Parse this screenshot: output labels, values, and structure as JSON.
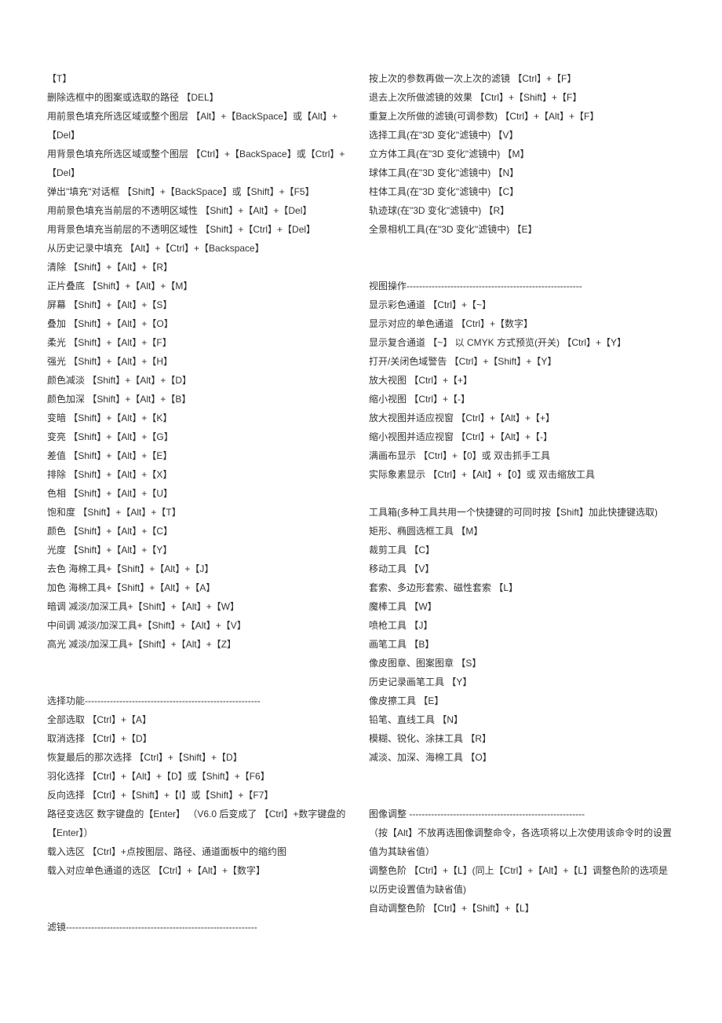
{
  "left": [
    "【T】",
    "删除选框中的图案或选取的路径 【DEL】",
    "用前景色填充所选区域或整个图层 【Alt】+【BackSpace】或【Alt】+【Del】",
    "用背景色填充所选区域或整个图层 【Ctrl】+【BackSpace】或【Ctrl】+【Del】",
    "弹出\"填充\"对话框 【Shift】+【BackSpace】或【Shift】+【F5】",
    "用前景色填充当前层的不透明区域性 【Shift】+【Alt】+【Del】",
    "用背景色填充当前层的不透明区域性 【Shift】+【Ctrl】+【Del】",
    "从历史记录中填充 【Alt】+【Ctrl】+【Backspace】",
    "清除 【Shift】+【Alt】+【R】",
    "正片叠底 【Shift】+【Alt】+【M】",
    "屏幕 【Shift】+【Alt】+【S】",
    "叠加 【Shift】+【Alt】+【O】",
    "柔光 【Shift】+【Alt】+【F】",
    "强光 【Shift】+【Alt】+【H】",
    "颜色减淡 【Shift】+【Alt】+【D】",
    "颜色加深 【Shift】+【Alt】+【B】",
    "变暗 【Shift】+【Alt】+【K】",
    "变亮 【Shift】+【Alt】+【G】",
    "差值 【Shift】+【Alt】+【E】",
    "排除 【Shift】+【Alt】+【X】",
    "色相 【Shift】+【Alt】+【U】",
    "饱和度 【Shift】+【Alt】+【T】",
    "颜色 【Shift】+【Alt】+【C】",
    "光度 【Shift】+【Alt】+【Y】",
    "去色 海棉工具+【Shift】+【Alt】+【J】",
    "加色 海棉工具+【Shift】+【Alt】+【A】",
    "暗调 减淡/加深工具+【Shift】+【Alt】+【W】",
    "中间调 减淡/加深工具+【Shift】+【Alt】+【V】",
    "高光 减淡/加深工具+【Shift】+【Alt】+【Z】",
    "",
    "",
    "选择功能--------------------------------------------------------",
    "全部选取 【Ctrl】+【A】",
    "取消选择 【Ctrl】+【D】",
    "恢复最后的那次选择 【Ctrl】+【Shift】+【D】",
    "羽化选择 【Ctrl】+【Alt】+【D】或【Shift】+【F6】",
    "反向选择 【Ctrl】+【Shift】+【I】或【Shift】+【F7】",
    "路径变选区 数字键盘的【Enter】 （V6.0 后变成了 【Ctrl】+数字键盘的【Enter】）",
    "载入选区 【Ctrl】+点按图层、路径、通道面板中的缩约图",
    "载入对应单色通道的选区 【Ctrl】+【Alt】+【数字】",
    "",
    "",
    "滤镜-------------------------------------------------------------"
  ],
  "right": [
    "按上次的参数再做一次上次的滤镜 【Ctrl】+【F】",
    "退去上次所做滤镜的效果 【Ctrl】+【Shift】+【F】",
    "重复上次所做的滤镜(可调参数) 【Ctrl】+【Alt】+【F】",
    "选择工具(在\"3D 变化\"滤镜中) 【V】",
    "立方体工具(在\"3D 变化\"滤镜中) 【M】",
    "球体工具(在\"3D 变化\"滤镜中) 【N】",
    "柱体工具(在\"3D 变化\"滤镜中) 【C】",
    "轨迹球(在\"3D 变化\"滤镜中) 【R】",
    "全景相机工具(在\"3D 变化\"滤镜中) 【E】",
    "",
    "",
    "视图操作--------------------------------------------------------",
    "显示彩色通道 【Ctrl】+【~】",
    "显示对应的单色通道 【Ctrl】+【数字】",
    "显示复合通道 【~】 以 CMYK 方式预览(开关) 【Ctrl】+【Y】",
    "打开/关闭色域警告 【Ctrl】+【Shift】+【Y】",
    "放大视图 【Ctrl】+【+】",
    "缩小视图 【Ctrl】+【-】",
    "放大视图并适应视窗 【Ctrl】+【Alt】+【+】",
    "缩小视图并适应视窗 【Ctrl】+【Alt】+【-】",
    "满画布显示 【Ctrl】+【0】或 双击抓手工具",
    "实际象素显示 【Ctrl】+【Alt】+【0】或 双击缩放工具",
    "",
    "工具箱(多种工具共用一个快捷键的可同时按【Shift】加此快捷键选取)",
    "矩形、椭圆选框工具 【M】",
    "裁剪工具 【C】",
    "移动工具 【V】",
    "套索、多边形套索、磁性套索 【L】",
    "魔棒工具 【W】",
    "喷枪工具 【J】",
    "画笔工具 【B】",
    "像皮图章、图案图章 【S】",
    "历史记录画笔工具 【Y】",
    "像皮擦工具 【E】",
    "铅笔、直线工具 【N】",
    "模糊、锐化、涂抹工具 【R】",
    "减淡、加深、海棉工具 【O】",
    "",
    "",
    "图像调整 --------------------------------------------------------",
    "（按【Alt】不放再选图像调整命令，各选项将以上次使用该命令时的设置值为其缺省值）",
    "调整色阶 【Ctrl】+【L】(同上【Ctrl】+【Alt】+【L】调整色阶的选项是以历史设置值为缺省值)",
    "自动调整色阶 【Ctrl】+【Shift】+【L】"
  ]
}
